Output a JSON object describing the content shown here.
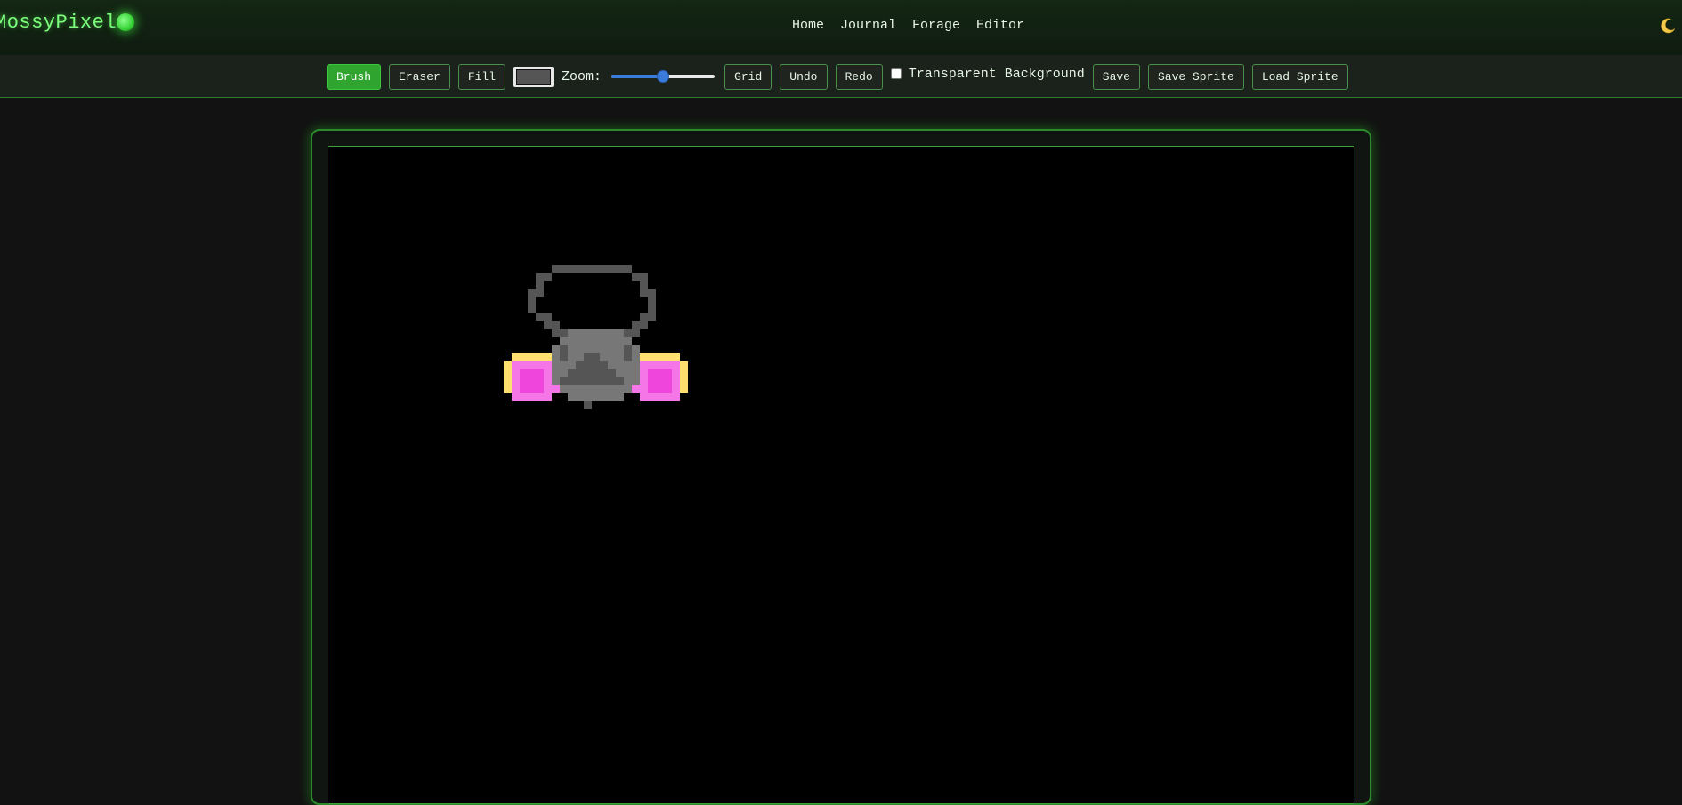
{
  "app": {
    "logo_text": "MossyPixel"
  },
  "nav": {
    "items": [
      {
        "label": "Home"
      },
      {
        "label": "Journal"
      },
      {
        "label": "Forage"
      },
      {
        "label": "Editor"
      }
    ],
    "theme_icon": "moon-icon"
  },
  "toolbar": {
    "brush_label": "Brush",
    "eraser_label": "Eraser",
    "fill_label": "Fill",
    "active_tool": "Brush",
    "current_color": "#555555",
    "zoom_label": "Zoom:",
    "zoom_level": 0.5,
    "grid_label": "Grid",
    "undo_label": "Undo",
    "redo_label": "Redo",
    "transparent_bg_label": "Transparent Background",
    "transparent_bg_checked": false,
    "save_label": "Save",
    "save_sprite_label": "Save Sprite",
    "load_sprite_label": "Load Sprite"
  },
  "colors": {
    "accent": "#2fa52f",
    "logo": "#7dff7d",
    "canvas_bg": "#000000",
    "sprite_dark": "#555555",
    "sprite_light": "#777777",
    "sprite_yellow": "#ffe06e",
    "sprite_pink": "#f576e6",
    "sprite_magenta": "#ef45dc"
  }
}
